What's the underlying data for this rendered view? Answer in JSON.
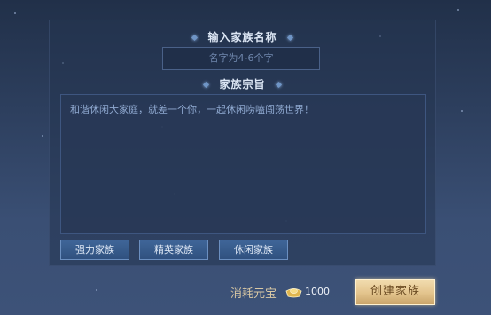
{
  "form": {
    "name_section_title": "输入家族名称",
    "name_placeholder": "名字为4-6个字",
    "purpose_section_title": "家族宗旨",
    "purpose_text": "和谐休闲大家庭，就差一个你，一起休闲唠嗑闯荡世界！"
  },
  "tags": [
    {
      "label": "强力家族"
    },
    {
      "label": "精英家族"
    },
    {
      "label": "休闲家族"
    }
  ],
  "footer": {
    "cost_label": "消耗元宝",
    "cost_icon": "gold-ingot-icon",
    "cost_value": "1000",
    "create_button_label": "创建家族"
  },
  "colors": {
    "background": "#2d3f5e",
    "panel": "#243450",
    "tag_button": "#3a5c8c",
    "create_button": "#e3c48d"
  }
}
